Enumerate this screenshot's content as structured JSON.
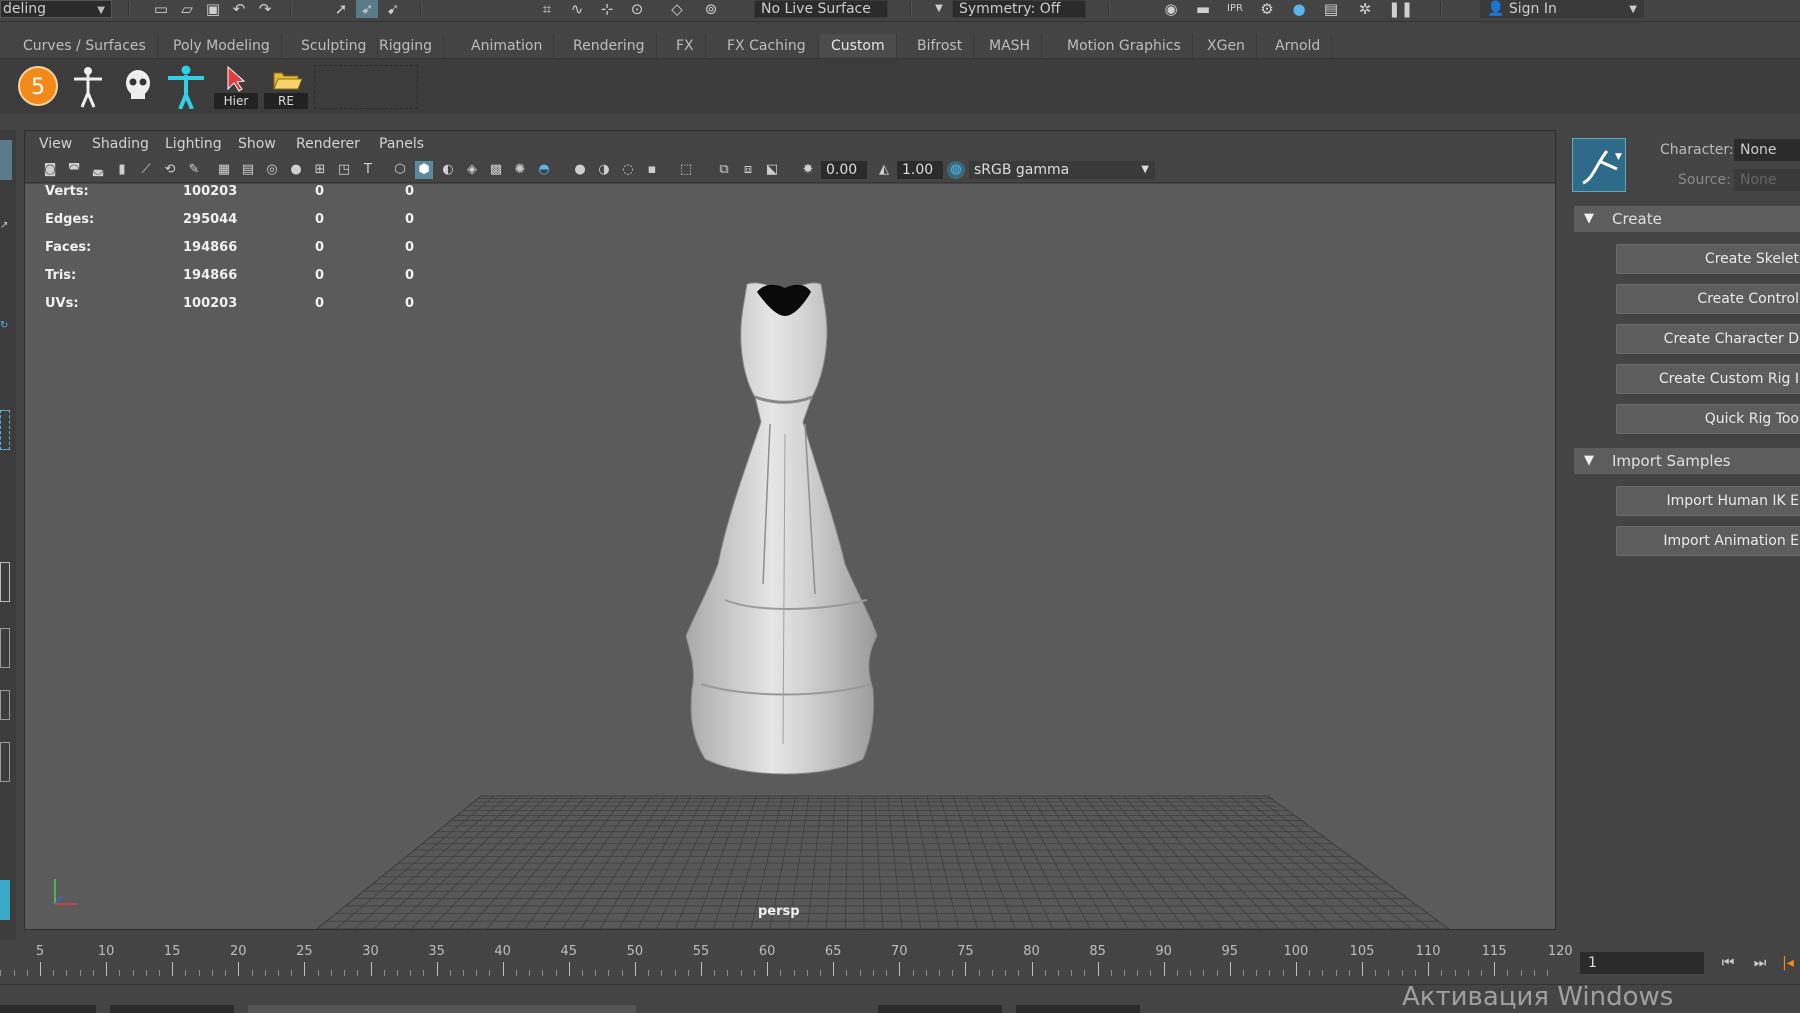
{
  "statusline": {
    "mode": "deling",
    "live_surface": "No Live Surface",
    "symmetry": "Symmetry: Off",
    "sign_in": "Sign In",
    "icons": [
      "new-scene-icon",
      "open-scene-icon",
      "save-scene-icon",
      "undo-icon",
      "redo-icon",
      "select-tool-icon",
      "lasso-select-icon",
      "paint-select-icon",
      "snap-grid-icon",
      "snap-curve-icon",
      "snap-point-icon",
      "snap-projected-icon",
      "snap-view-plane-icon",
      "snap-live-icon",
      "render-view-icon",
      "render-frame-icon",
      "ipr-render-icon",
      "render-settings-icon",
      "hypershade-icon",
      "render-setup-icon",
      "light-editor-icon",
      "pause-viewport-icon",
      "user-icon"
    ]
  },
  "shelf": {
    "tabs": [
      "Curves / Surfaces",
      "Poly Modeling",
      "Sculpting",
      "Rigging",
      "Animation",
      "Rendering",
      "FX",
      "FX Caching",
      "Custom",
      "Bifrost",
      "MASH",
      "Motion Graphics",
      "XGen",
      "Arnold"
    ],
    "active_tab": "Custom",
    "buttons": {
      "number_badge": "5",
      "hier": "Hier",
      "re": "RE"
    }
  },
  "panel_menu": [
    "View",
    "Shading",
    "Lighting",
    "Show",
    "Renderer",
    "Panels"
  ],
  "panel_toolbar": {
    "exposure": "0.00",
    "gamma": "1.00",
    "color_space": "sRGB gamma"
  },
  "hud": {
    "rows": [
      {
        "label": "Verts:",
        "value": "100203",
        "sel": "0",
        "sel2": "0"
      },
      {
        "label": "Edges:",
        "value": "295044",
        "sel": "0",
        "sel2": "0"
      },
      {
        "label": "Faces:",
        "value": "194866",
        "sel": "0",
        "sel2": "0"
      },
      {
        "label": "Tris:",
        "value": "194866",
        "sel": "0",
        "sel2": "0"
      },
      {
        "label": "UVs:",
        "value": "100203",
        "sel": "0",
        "sel2": "0"
      }
    ],
    "camera": "persp"
  },
  "right_panel": {
    "character_label": "Character:",
    "character_value": "None",
    "source_label": "Source:",
    "source_value": "None",
    "sections": [
      {
        "title": "Create",
        "buttons": [
          "Create Skelet",
          "Create Control",
          "Create Character D",
          "Create Custom Rig I",
          "Quick Rig Too"
        ]
      },
      {
        "title": "Import Samples",
        "buttons": [
          "Import Human IK E",
          "Import Animation E"
        ]
      }
    ]
  },
  "timeline": {
    "ticks": [
      "5",
      "10",
      "15",
      "20",
      "25",
      "30",
      "35",
      "40",
      "45",
      "50",
      "55",
      "60",
      "65",
      "70",
      "75",
      "80",
      "85",
      "90",
      "95",
      "100",
      "105",
      "110",
      "115",
      "120"
    ],
    "current_frame": "1"
  },
  "watermark": "Активация Windows",
  "colors": {
    "viewport_bg": "#5b5b5b",
    "accent_blue": "#5ab4e8",
    "grid": "#3e3e3e",
    "badge_orange": "#f28a1a"
  }
}
